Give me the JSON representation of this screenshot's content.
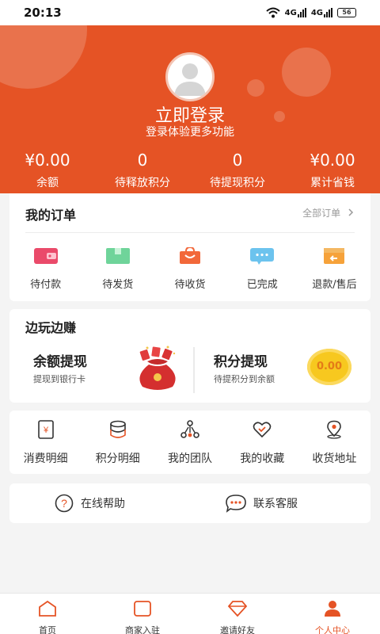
{
  "status_bar": {
    "time": "20:13",
    "signal1": "4G",
    "signal2": "4G",
    "battery": "56"
  },
  "header": {
    "login_title": "立即登录",
    "login_subtitle": "登录体验更多功能",
    "stats": [
      {
        "value": "¥0.00",
        "label": "余额"
      },
      {
        "value": "0",
        "label": "待释放积分"
      },
      {
        "value": "0",
        "label": "待提现积分"
      },
      {
        "value": "¥0.00",
        "label": "累计省钱"
      }
    ]
  },
  "orders": {
    "title": "我的订单",
    "all_label": "全部订单",
    "items": [
      {
        "label": "待付款",
        "icon": "wallet-icon"
      },
      {
        "label": "待发货",
        "icon": "package-icon"
      },
      {
        "label": "待收货",
        "icon": "bag-icon"
      },
      {
        "label": "已完成",
        "icon": "chat-done-icon"
      },
      {
        "label": "退款/售后",
        "icon": "refund-icon"
      }
    ]
  },
  "earn": {
    "title": "边玩边赚",
    "withdraw_title": "余额提现",
    "withdraw_sub": "提现到银行卡",
    "points_title": "积分提现",
    "points_sub": "待提积分到余额",
    "coin_value": "0.00"
  },
  "tools": {
    "items": [
      {
        "label": "消费明细",
        "icon": "receipt-icon"
      },
      {
        "label": "积分明细",
        "icon": "coins-icon"
      },
      {
        "label": "我的团队",
        "icon": "team-icon"
      },
      {
        "label": "我的收藏",
        "icon": "heart-icon"
      },
      {
        "label": "收货地址",
        "icon": "location-icon"
      }
    ]
  },
  "help": {
    "online_help": "在线帮助",
    "contact_service": "联系客服"
  },
  "tabbar": {
    "items": [
      {
        "label": "首页",
        "icon": "home-icon"
      },
      {
        "label": "商家入驻",
        "icon": "store-icon"
      },
      {
        "label": "邀请好友",
        "icon": "diamond-icon"
      },
      {
        "label": "个人中心",
        "icon": "profile-icon"
      }
    ],
    "active_index": 3
  },
  "colors": {
    "brand": "#e55325",
    "background": "#f4f4f4"
  }
}
